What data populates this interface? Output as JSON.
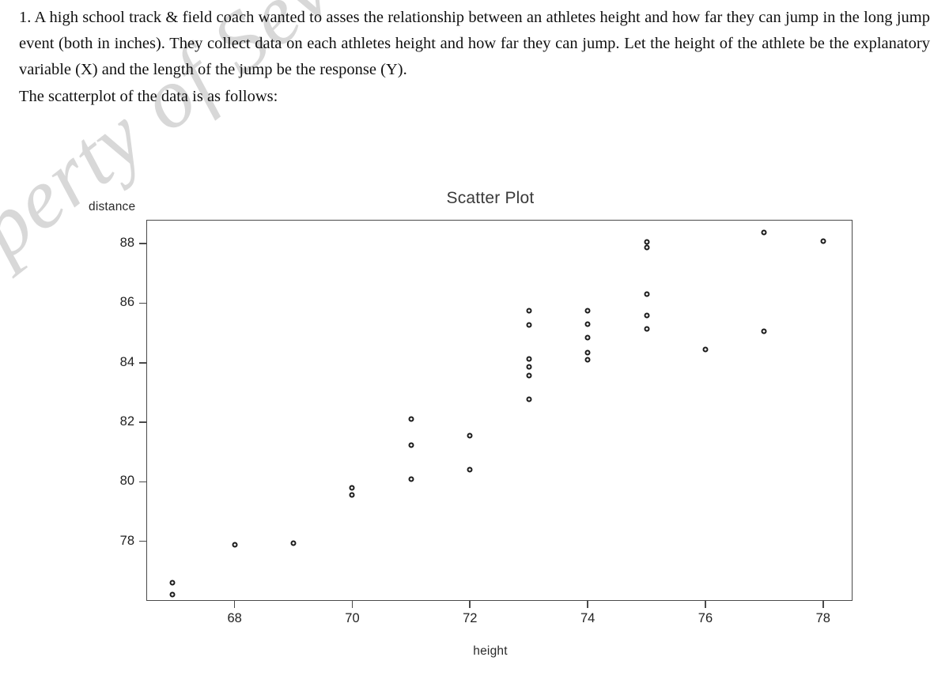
{
  "problem": {
    "number": "1.",
    "paragraph": "1.  A high school track & field coach wanted to asses the relationship between an athletes height and how far they can jump in the long jump event (both in inches).  They collect data on each athletes height and how far they can jump.  Let the height of the athlete be the explanatory variable (X) and the length of the jump be the response (Y).",
    "lead_in": "The scatterplot of the data is as follows:"
  },
  "watermark": {
    "text": "roperty of Sevan Krikor",
    "color": "#d8d8d8"
  },
  "chart_data": {
    "type": "scatter",
    "title": "Scatter Plot",
    "xlabel": "height",
    "ylabel": "distance",
    "xlim": [
      66.5,
      78.5
    ],
    "ylim": [
      76.0,
      88.8
    ],
    "xticks": [
      68,
      70,
      72,
      74,
      76,
      78
    ],
    "yticks": [
      78,
      80,
      82,
      84,
      86,
      88
    ],
    "grid": false,
    "legend": "none",
    "marker": "open-circle",
    "marker_color": "#1b1b1b",
    "points": [
      {
        "x": 66.95,
        "y": 76.6
      },
      {
        "x": 66.95,
        "y": 76.2
      },
      {
        "x": 68.0,
        "y": 77.88
      },
      {
        "x": 69.0,
        "y": 77.95
      },
      {
        "x": 70.0,
        "y": 79.8
      },
      {
        "x": 70.0,
        "y": 79.55
      },
      {
        "x": 71.0,
        "y": 82.1
      },
      {
        "x": 71.0,
        "y": 81.23
      },
      {
        "x": 71.0,
        "y": 80.1
      },
      {
        "x": 72.0,
        "y": 81.55
      },
      {
        "x": 72.0,
        "y": 80.4
      },
      {
        "x": 73.0,
        "y": 85.75
      },
      {
        "x": 73.0,
        "y": 85.28
      },
      {
        "x": 73.0,
        "y": 84.13
      },
      {
        "x": 73.0,
        "y": 83.85
      },
      {
        "x": 73.0,
        "y": 83.58
      },
      {
        "x": 73.0,
        "y": 82.78
      },
      {
        "x": 74.0,
        "y": 85.75
      },
      {
        "x": 74.0,
        "y": 85.3
      },
      {
        "x": 74.0,
        "y": 84.85
      },
      {
        "x": 74.0,
        "y": 84.33
      },
      {
        "x": 74.0,
        "y": 84.1
      },
      {
        "x": 75.0,
        "y": 88.05
      },
      {
        "x": 75.0,
        "y": 87.88
      },
      {
        "x": 75.0,
        "y": 86.3
      },
      {
        "x": 75.0,
        "y": 85.6
      },
      {
        "x": 75.0,
        "y": 85.13
      },
      {
        "x": 76.0,
        "y": 84.45
      },
      {
        "x": 77.0,
        "y": 88.38
      },
      {
        "x": 77.0,
        "y": 85.05
      },
      {
        "x": 78.0,
        "y": 88.08
      }
    ]
  }
}
